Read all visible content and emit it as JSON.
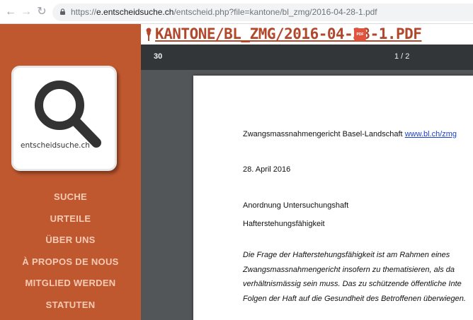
{
  "browser": {
    "url_prefix": "https://",
    "url_host": "e.entscheidsuche.ch",
    "url_path": "/entscheid.php?file=kantone/bl_zmg/2016-04-28-1.pdf"
  },
  "sidebar": {
    "logo_text": "entscheidsuche.ch",
    "menu": [
      "SUCHE",
      "URTEILE",
      "ÜBER UNS",
      "À PROPOS DE NOUS",
      "MITGLIED WERDEN",
      "STATUTEN"
    ]
  },
  "document": {
    "title": "KANTONE/BL_ZMG/2016-04-28-1.PDF",
    "pdf_badge": "PDF"
  },
  "viewer": {
    "toolbar_left": "30",
    "page_indicator": "1 / 2"
  },
  "page": {
    "court": "Zwangsmassnahmengericht Basel-Landschaft",
    "court_link": "www.bl.ch/zmg",
    "date": "28. April 2016",
    "subject1": "Anordnung Untersuchungshaft",
    "subject2": "Hafterstehungsfähigkeit",
    "para": [
      "Die Frage der Hafterstehungsfähigkeit ist am Rahmen eines",
      "Zwangsmassnahmengericht insofern zu thematisieren, als da",
      "verhältnismässig sein muss. Das zu schützende öffentliche Inte",
      "Folgen der Haft auf die Gesundheit des Betroffenen überwiegen."
    ]
  },
  "colors": {
    "sidebar": "#c0582f",
    "title": "#b2472c",
    "toolbar": "#323639",
    "viewer_bg": "#525659"
  }
}
